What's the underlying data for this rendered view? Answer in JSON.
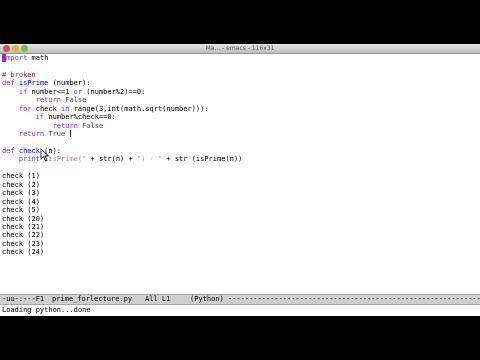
{
  "window": {
    "title": "Ma... - emacs - 116x31"
  },
  "editor": {
    "lines": [
      [
        {
          "t": "import",
          "k": "kw"
        },
        {
          "t": " math",
          "k": "plain"
        }
      ],
      [],
      [
        {
          "t": "# broken",
          "k": "comment"
        }
      ],
      [
        {
          "t": "def ",
          "k": "kw"
        },
        {
          "t": "isPrime",
          "k": "fn"
        },
        {
          "t": " (number):",
          "k": "plain"
        }
      ],
      [
        {
          "t": "    ",
          "k": "plain"
        },
        {
          "t": "if",
          "k": "kw"
        },
        {
          "t": " number<=1 ",
          "k": "plain"
        },
        {
          "t": "or",
          "k": "kw"
        },
        {
          "t": " (number%2)==0:",
          "k": "plain"
        }
      ],
      [
        {
          "t": "        ",
          "k": "plain"
        },
        {
          "t": "return",
          "k": "kw"
        },
        {
          "t": " ",
          "k": "plain"
        },
        {
          "t": "False",
          "k": "builtin"
        }
      ],
      [
        {
          "t": "    ",
          "k": "plain"
        },
        {
          "t": "for",
          "k": "kw"
        },
        {
          "t": " check ",
          "k": "plain"
        },
        {
          "t": "in",
          "k": "kw"
        },
        {
          "t": " range(3,int(math.sqrt(number))):",
          "k": "plain"
        }
      ],
      [
        {
          "t": "        ",
          "k": "plain"
        },
        {
          "t": "if",
          "k": "kw"
        },
        {
          "t": " number%check==0:",
          "k": "plain"
        }
      ],
      [
        {
          "t": "            ",
          "k": "plain"
        },
        {
          "t": "return",
          "k": "kw"
        },
        {
          "t": " ",
          "k": "plain"
        },
        {
          "t": "False",
          "k": "builtin"
        }
      ],
      [
        {
          "t": "    ",
          "k": "plain"
        },
        {
          "t": "return",
          "k": "kw"
        },
        {
          "t": " ",
          "k": "plain"
        },
        {
          "t": "True",
          "k": "builtin"
        }
      ],
      [],
      [
        {
          "t": "def ",
          "k": "kw"
        },
        {
          "t": "check",
          "k": "fn"
        },
        {
          "t": " (n):",
          "k": "plain"
        }
      ],
      [
        {
          "t": "    ",
          "k": "plain"
        },
        {
          "t": "print",
          "k": "kw"
        },
        {
          "t": " ",
          "k": "plain"
        },
        {
          "t": "\"isPrime(\"",
          "k": "str"
        },
        {
          "t": " + str(n) + ",
          "k": "plain"
        },
        {
          "t": "\") - \"",
          "k": "str"
        },
        {
          "t": " + str (isPrime(n))",
          "k": "plain"
        }
      ],
      [],
      [
        {
          "t": "check (1)",
          "k": "plain"
        }
      ],
      [
        {
          "t": "check (2)",
          "k": "plain"
        }
      ],
      [
        {
          "t": "check (3)",
          "k": "plain"
        }
      ],
      [
        {
          "t": "check (4)",
          "k": "plain"
        }
      ],
      [
        {
          "t": "check (5)",
          "k": "plain"
        }
      ],
      [
        {
          "t": "check (20)",
          "k": "plain"
        }
      ],
      [
        {
          "t": "check (21)",
          "k": "plain"
        }
      ],
      [
        {
          "t": "check (22)",
          "k": "plain"
        }
      ],
      [
        {
          "t": "check (23)",
          "k": "plain"
        }
      ],
      [
        {
          "t": "check (24)",
          "k": "plain"
        }
      ]
    ]
  },
  "modeline": {
    "status": "-uu-:---F1",
    "buffer_name": "prime_forlecture.py",
    "position": "All L1",
    "mode": "(Python)",
    "fill": "-------------------------------------------------------------------"
  },
  "minibuffer": {
    "message": "Loading python...done"
  },
  "colors": {
    "keyword": "#8a2be2",
    "string": "#bc8f8f",
    "comment": "#b22222",
    "function": "#0000ff",
    "builtin": "#483d8b",
    "cursor": "#8a2be2",
    "modeline_bg": "#cfcfcf"
  },
  "icons": {
    "close": "close-icon",
    "minimize": "minimize-icon",
    "zoom": "zoom-icon",
    "pointer": "mouse-pointer-icon"
  }
}
